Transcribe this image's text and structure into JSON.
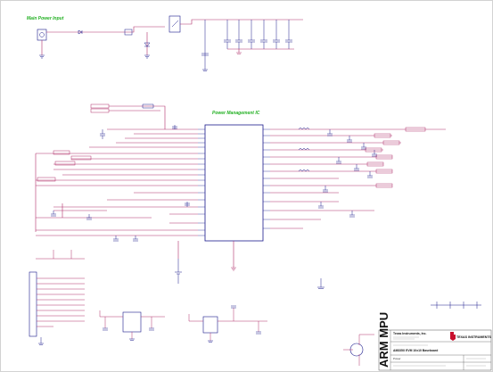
{
  "sections": {
    "main_power_input": "Main Power Input",
    "power_management_ic": "Power Management IC"
  },
  "title_block": {
    "side_banner": "ARM MPU",
    "company": "Texas Instruments, Inc.",
    "logo_text": "TEXAS INSTRUMENTS",
    "board_title": "AM335X EVM 10x10 Baseboard",
    "sheet_name": "Power"
  },
  "colors": {
    "wire": "#b0306a",
    "component": "#1a1a8c",
    "section_title": "#22b022",
    "border": "#c0c0c0"
  }
}
